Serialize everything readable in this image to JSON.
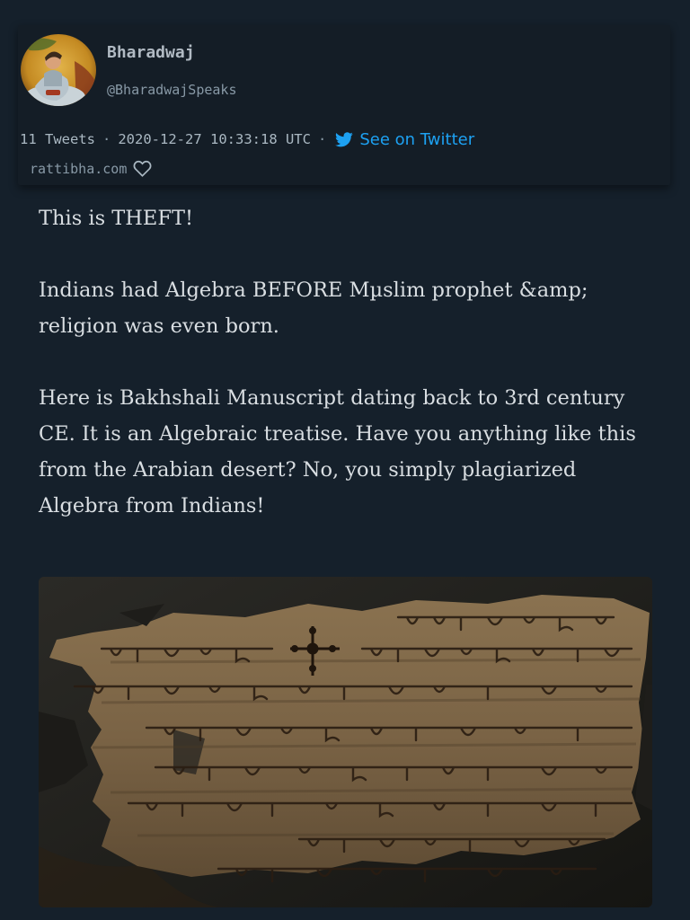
{
  "author": {
    "name": "Bharadwaj",
    "handle": "@BharadwajSpeaks",
    "avatar_icon": "miniature-painting-avatar"
  },
  "meta": {
    "tweet_count": "11 Tweets",
    "separator": "·",
    "timestamp": "2020-12-27 10:33:18 UTC",
    "twitter_link_label": "See on Twitter",
    "site": "rattibha.com"
  },
  "tweet": {
    "paragraphs": [
      "This is THEFT!",
      "Indians had Algebra BEFORE Mµslim prophet &amp; religion was even born.",
      "Here is Bakhshali Manuscript dating back to 3rd century CE. It is an Algebraic treatise. Have you anything like this from the Arabian desert? No, you simply plagiarized Algebra from Indians!"
    ]
  },
  "media": {
    "description_icon": "manuscript-photo"
  },
  "colors": {
    "background": "#15202b",
    "card": "#141d26",
    "twitter_blue": "#1da1f2",
    "text": "#d9dee2",
    "muted": "#8899a6"
  }
}
